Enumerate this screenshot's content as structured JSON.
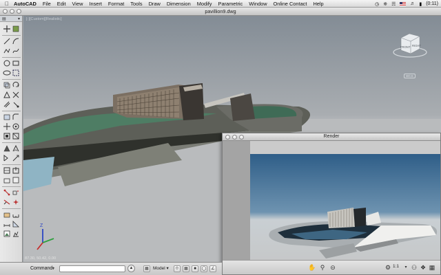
{
  "menubar": {
    "app_name": "AutoCAD",
    "items": [
      "File",
      "Edit",
      "View",
      "Insert",
      "Format",
      "Tools",
      "Draw",
      "Dimension",
      "Modify",
      "Parametric",
      "Window",
      "Online Contact",
      "Help"
    ],
    "clock": "(0:11)"
  },
  "document": {
    "title": "pavillion9.dwg"
  },
  "viewport": {
    "label": "[-][Custom][Realistic]",
    "viewcube_front": "FRONT",
    "viewcube_right": "RIGHT",
    "wcs_label": "WCS",
    "coordinates": "87.30, 50.42, 0.00"
  },
  "render_window": {
    "title": "Render",
    "zoom": "1:1"
  },
  "statusbar": {
    "command_label": "Command:",
    "model_label": "Model"
  },
  "colors": {
    "viewport_sky": "#838c95",
    "viewport_ground": "#b3b5b7",
    "render_sky": "#3d6f97",
    "water": "#4e7d64"
  }
}
